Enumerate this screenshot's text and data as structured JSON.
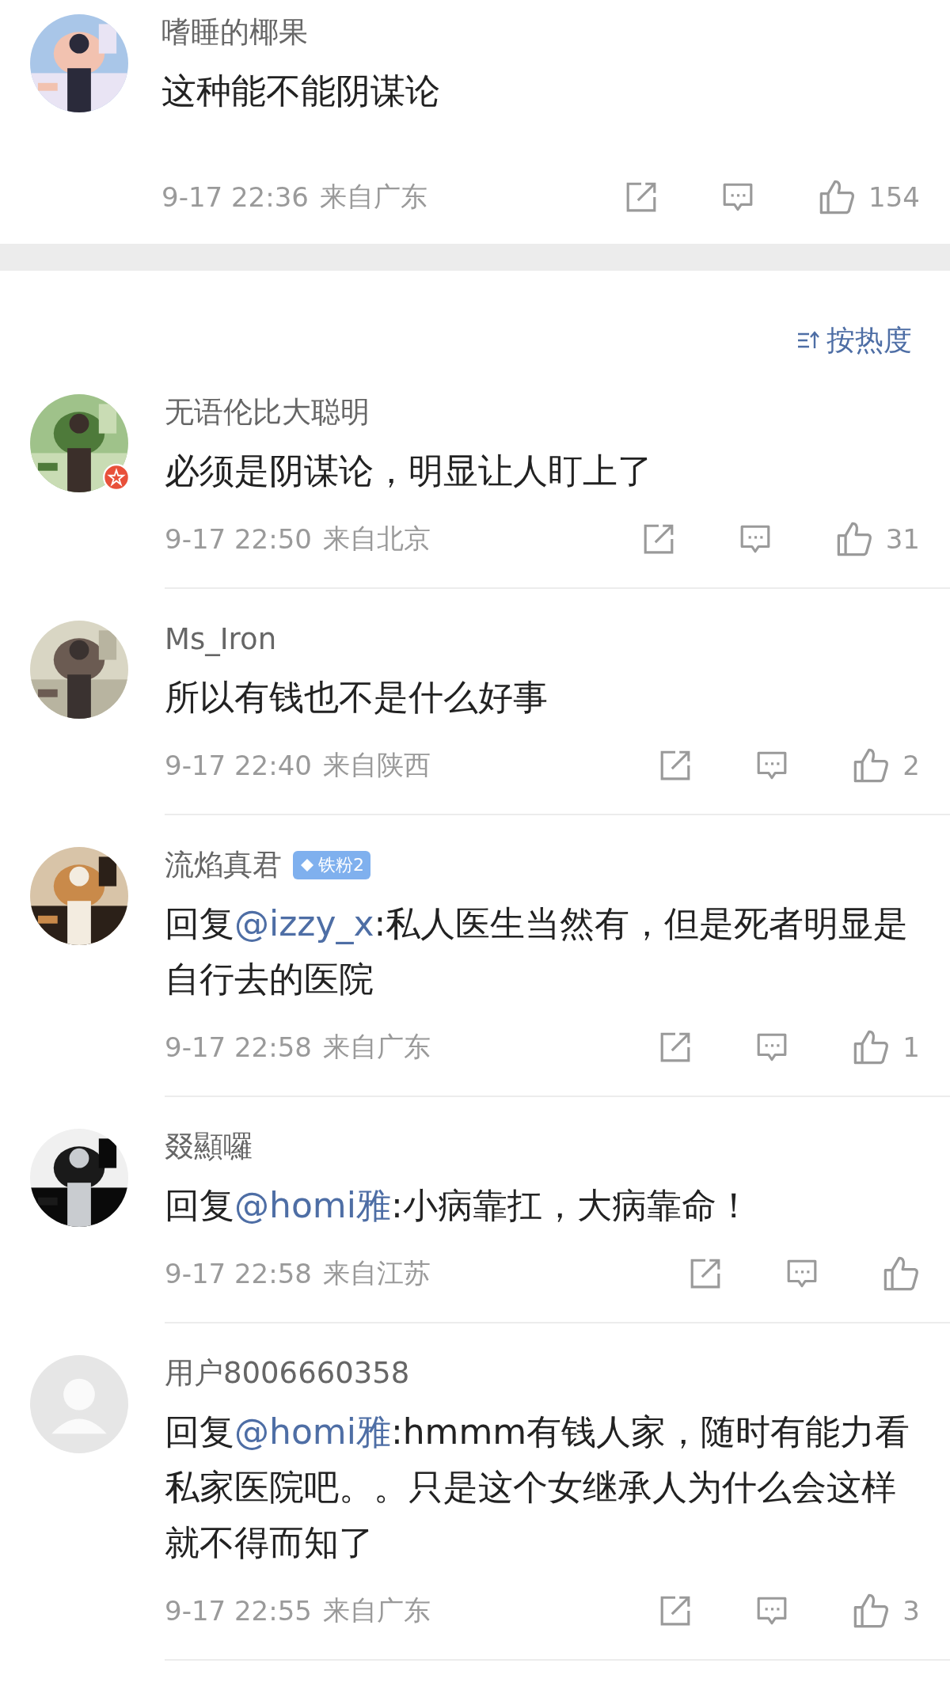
{
  "top_comment": {
    "author": "嗜睡的椰果",
    "content": [
      {
        "kind": "plain",
        "text": "这种能不能阴谋论"
      }
    ],
    "time": "9-17 22:36",
    "location": "来自广东",
    "like_count": "154"
  },
  "sort": {
    "label": "按热度"
  },
  "comments": [
    {
      "author": "无语伦比大聪明",
      "verified": true,
      "content": [
        {
          "kind": "plain",
          "text": "必须是阴谋论，明显让人盯上了"
        }
      ],
      "time": "9-17 22:50",
      "location": "来自北京",
      "like_count": "31"
    },
    {
      "author": "Ms_Iron",
      "content": [
        {
          "kind": "plain",
          "text": "所以有钱也不是什么好事"
        }
      ],
      "time": "9-17 22:40",
      "location": "来自陕西",
      "like_count": "2"
    },
    {
      "author": "流焰真君",
      "badge": "铁粉2",
      "content": [
        {
          "kind": "plain",
          "text": "回复"
        },
        {
          "kind": "mention",
          "text": "@izzy_x"
        },
        {
          "kind": "plain",
          "text": ":私人医生当然有，但是死者明显是自行去的医院"
        }
      ],
      "time": "9-17 22:58",
      "location": "来自广东",
      "like_count": "1"
    },
    {
      "author": "叕顯囉",
      "content": [
        {
          "kind": "plain",
          "text": "回复"
        },
        {
          "kind": "mention",
          "text": "@homi雅"
        },
        {
          "kind": "plain",
          "text": ":小病靠扛，大病靠命！"
        }
      ],
      "time": "9-17 22:58",
      "location": "来自江苏"
    },
    {
      "author": "用户8006660358",
      "default_avatar": true,
      "content": [
        {
          "kind": "plain",
          "text": "回复"
        },
        {
          "kind": "mention",
          "text": "@homi雅"
        },
        {
          "kind": "plain",
          "text": ":hmmm有钱人家，随时有能力看私家医院吧。。只是这个女继承人为什么会这样就不得而知了"
        }
      ],
      "time": "9-17 22:55",
      "location": "来自广东",
      "like_count": "3"
    }
  ]
}
